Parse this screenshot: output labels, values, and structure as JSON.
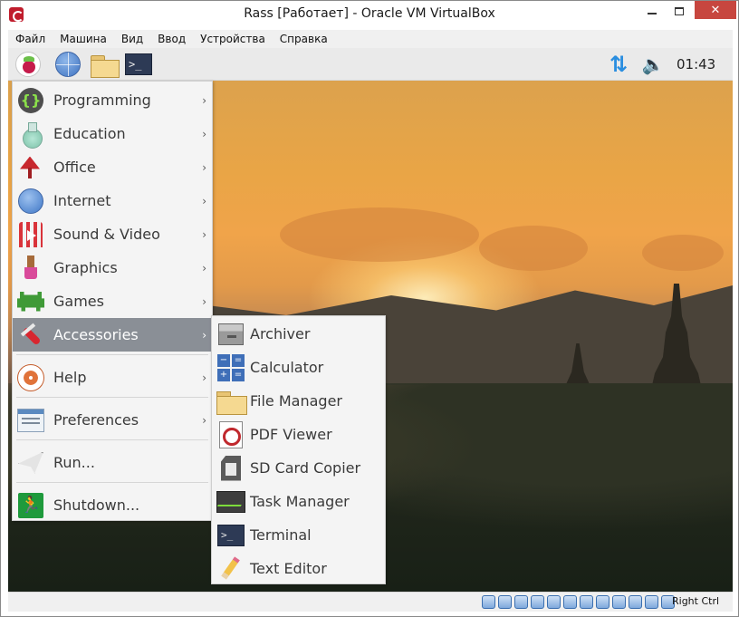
{
  "window": {
    "title": "Rass [Работает] - Oracle VM VirtualBox",
    "close_label": "✕"
  },
  "menubar": [
    "Файл",
    "Машина",
    "Вид",
    "Ввод",
    "Устройства",
    "Справка"
  ],
  "panel": {
    "terminal_glyph": ">_",
    "network_glyph": "⇅",
    "volume_glyph": "🔈",
    "clock": "01:43"
  },
  "main_menu": {
    "items": [
      {
        "label": "Programming",
        "icon": "programming-icon",
        "has_submenu": true
      },
      {
        "label": "Education",
        "icon": "education-icon",
        "has_submenu": true
      },
      {
        "label": "Office",
        "icon": "office-icon",
        "has_submenu": true
      },
      {
        "label": "Internet",
        "icon": "internet-icon",
        "has_submenu": true
      },
      {
        "label": "Sound & Video",
        "icon": "sound-video-icon",
        "has_submenu": true
      },
      {
        "label": "Graphics",
        "icon": "graphics-icon",
        "has_submenu": true
      },
      {
        "label": "Games",
        "icon": "games-icon",
        "has_submenu": true
      },
      {
        "label": "Accessories",
        "icon": "accessories-icon",
        "has_submenu": true,
        "active": true
      },
      {
        "label": "Help",
        "icon": "help-icon",
        "has_submenu": true
      },
      {
        "label": "Preferences",
        "icon": "preferences-icon",
        "has_submenu": true
      },
      {
        "label": "Run...",
        "icon": "run-icon",
        "has_submenu": false
      },
      {
        "label": "Shutdown...",
        "icon": "shutdown-icon",
        "has_submenu": false
      }
    ],
    "arrow": "›",
    "prog_glyph": "{}",
    "shutdown_glyph": "🏃"
  },
  "accessories_submenu": {
    "items": [
      {
        "label": "Archiver",
        "icon": "archiver-icon"
      },
      {
        "label": "Calculator",
        "icon": "calculator-icon"
      },
      {
        "label": "File Manager",
        "icon": "file-manager-icon"
      },
      {
        "label": "PDF Viewer",
        "icon": "pdf-viewer-icon"
      },
      {
        "label": "SD Card Copier",
        "icon": "sd-card-icon"
      },
      {
        "label": "Task Manager",
        "icon": "task-manager-icon"
      },
      {
        "label": "Terminal",
        "icon": "terminal-icon"
      },
      {
        "label": "Text Editor",
        "icon": "text-editor-icon"
      }
    ],
    "calc_glyphs": [
      "−",
      "=",
      "+",
      "="
    ]
  },
  "statusbar": {
    "host_key": "Right Ctrl"
  },
  "colors": {
    "menu_active": "#8a8f96",
    "close_button": "#c7463f",
    "panel_accent": "#2a8ee0"
  }
}
